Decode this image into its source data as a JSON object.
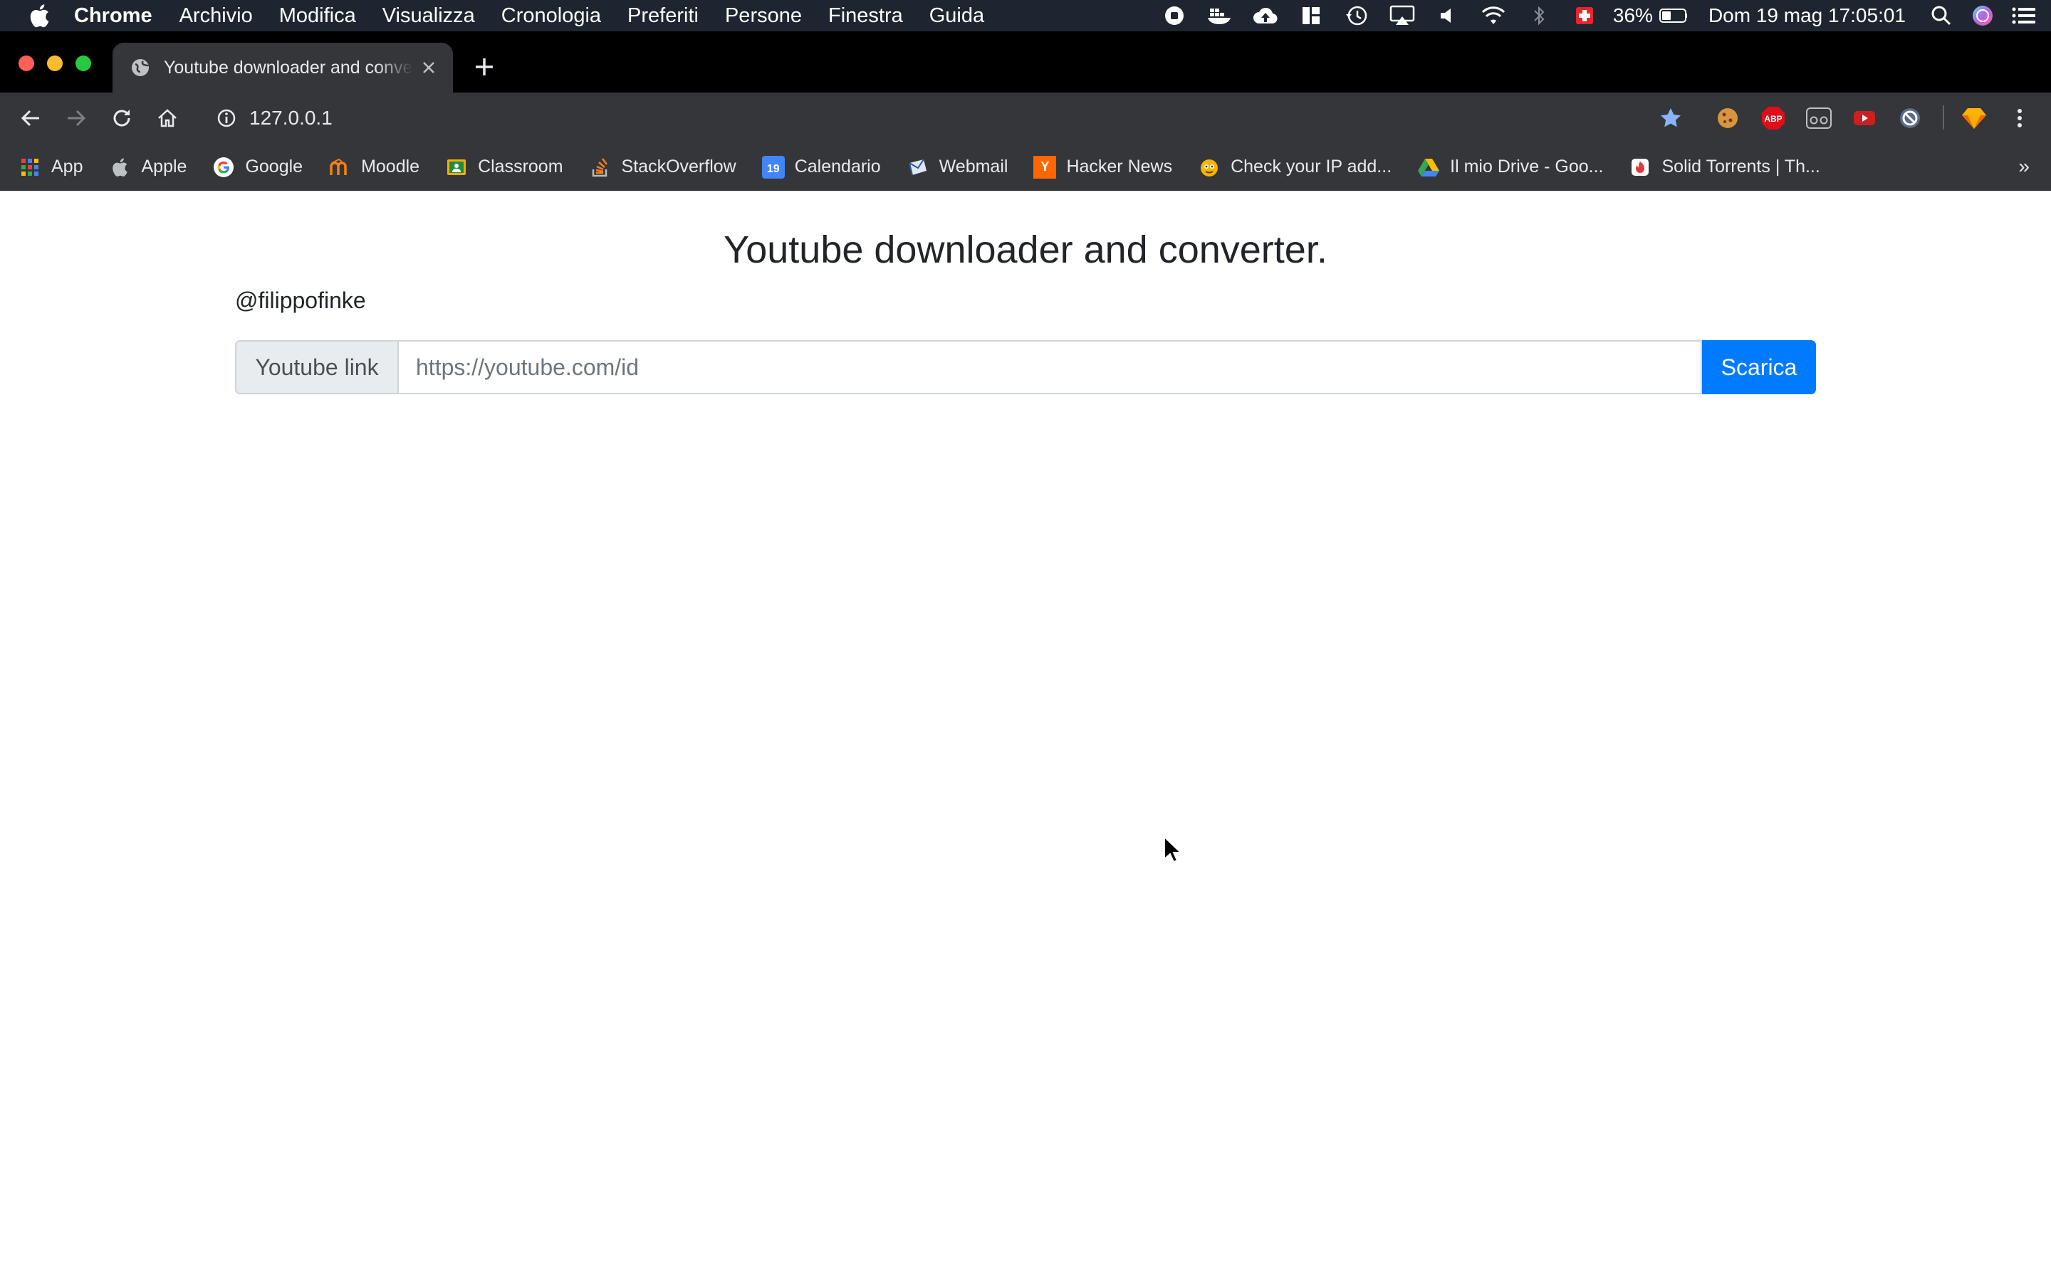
{
  "menubar": {
    "app_name": "Chrome",
    "items": [
      "Archivio",
      "Modifica",
      "Visualizza",
      "Cronologia",
      "Preferiti",
      "Persone",
      "Finestra",
      "Guida"
    ],
    "status_icons": [
      "record-icon",
      "docker-icon",
      "cloud-upload-icon",
      "layout-icon",
      "time-machine-icon",
      "airplay-icon",
      "volume-icon",
      "wifi-icon",
      "bluetooth-icon",
      "swiss-flag-icon",
      "battery-icon",
      "spotlight-icon",
      "siri-icon",
      "control-center-icon"
    ],
    "battery": "36%",
    "datetime": "Dom 19 mag  17:05:01"
  },
  "browser": {
    "tab_title": "Youtube downloader and converter.",
    "url": "127.0.0.1",
    "extensions": [
      "bookmark-star-icon",
      "cookie-icon",
      "adblock-plus-icon",
      "reader-icon",
      "youtube-ext-icon",
      "block-icon",
      "sketch-icon",
      "menu-kebab-icon"
    ],
    "adblock_label": "ABP"
  },
  "bookmarks": [
    {
      "label": "App",
      "icon": "apps-grid-icon"
    },
    {
      "label": "Apple",
      "icon": "apple-icon"
    },
    {
      "label": "Google",
      "icon": "google-icon"
    },
    {
      "label": "Moodle",
      "icon": "moodle-icon"
    },
    {
      "label": "Classroom",
      "icon": "classroom-icon"
    },
    {
      "label": "StackOverflow",
      "icon": "stackoverflow-icon"
    },
    {
      "label": "Calendario",
      "icon": "calendar-icon",
      "icon_text": "19"
    },
    {
      "label": "Webmail",
      "icon": "webmail-icon"
    },
    {
      "label": "Hacker News",
      "icon": "hacker-news-icon",
      "icon_text": "Y"
    },
    {
      "label": "Check your IP add...",
      "icon": "ip-check-icon"
    },
    {
      "label": "Il mio Drive - Goo...",
      "icon": "google-drive-icon"
    },
    {
      "label": "Solid Torrents | Th...",
      "icon": "solid-torrents-icon"
    }
  ],
  "bookmarks_more": "»",
  "page": {
    "title": "Youtube downloader and converter.",
    "author": "@filippofinke",
    "input_prefix": "Youtube link",
    "input_placeholder": "https://youtube.com/id",
    "input_value": "",
    "button_label": "Scarica"
  },
  "colors": {
    "primary_button": "#007bff",
    "menubar_bg": "#1f2530",
    "toolbar_bg": "#35363a"
  }
}
